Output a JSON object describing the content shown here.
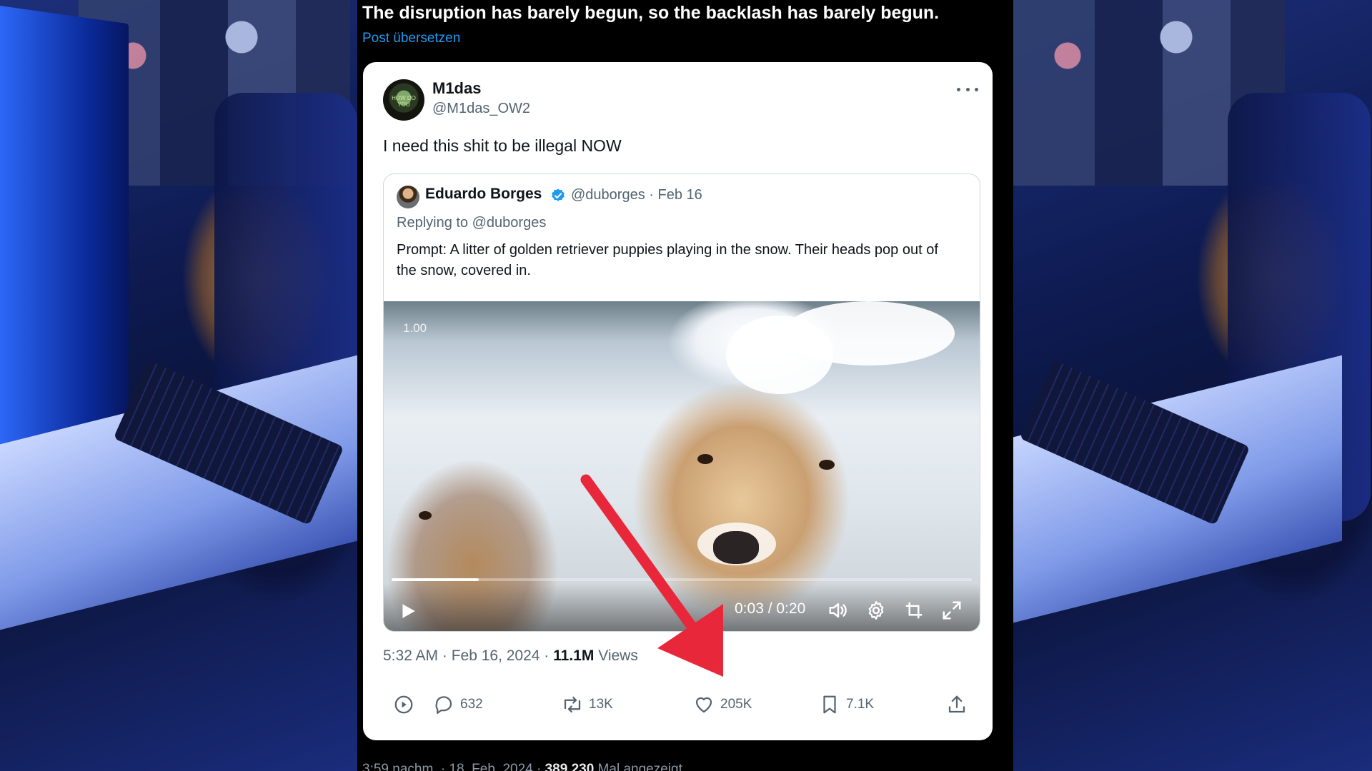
{
  "headline": "The disruption has barely begun, so the backlash has barely begun.",
  "translate_link": "Post übersetzen",
  "tweet": {
    "avatar_text": "HOW DO YOU",
    "author_name": "M1das",
    "author_handle": "@M1das_OW2",
    "text": "I need this shit to be illegal NOW",
    "quoted": {
      "author_name": "Eduardo Borges",
      "handle_date": "@duborges · Feb 16",
      "replying_to": "Replying to @duborges",
      "prompt": "Prompt: A litter of golden retriever puppies playing in the snow. Their heads pop out of the snow, covered in.",
      "video": {
        "speed_badge": "1.00",
        "time": "0:03 / 0:20",
        "progress": 0.15
      }
    },
    "meta": {
      "timestamp": "5:32 AM · Feb 16, 2024 · ",
      "views_count": "11.1M",
      "views_label": " Views"
    },
    "actions": {
      "replies": "632",
      "reposts": "13K",
      "likes": "205K",
      "bookmarks": "7.1K"
    }
  },
  "below": {
    "timestamp": "3:59 nachm. · 18. Feb. 2024 · ",
    "views_count": "389.230",
    "views_label": " Mal angezeigt"
  },
  "colors": {
    "link": "#1d9bf0",
    "verified": "#1d9bf0",
    "arrow": "#e8283a",
    "card_bg": "#ffffff"
  },
  "icons": [
    "more-icon",
    "verified-badge-icon",
    "play-icon",
    "volume-icon",
    "settings-icon",
    "pip-icon",
    "fullscreen-icon",
    "views-icon",
    "reply-icon",
    "repost-icon",
    "like-icon",
    "bookmark-icon",
    "share-icon"
  ]
}
